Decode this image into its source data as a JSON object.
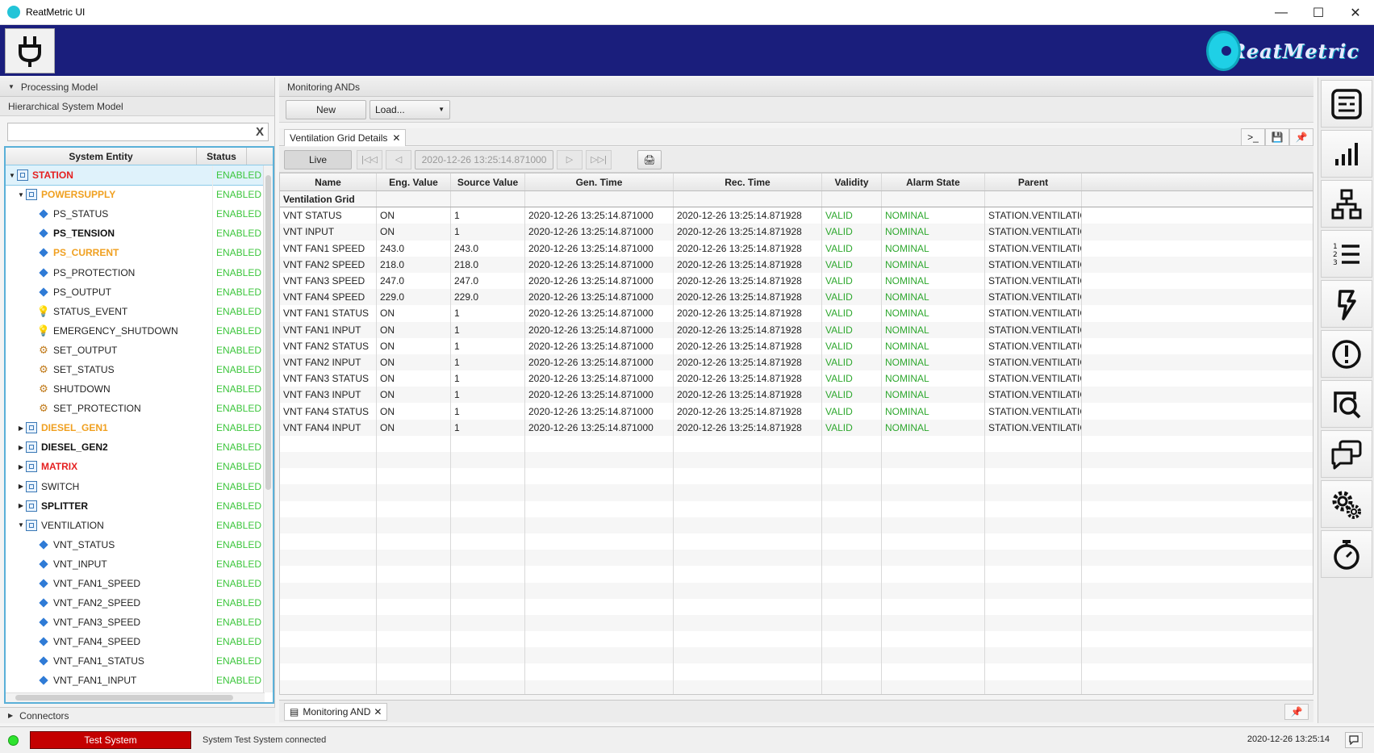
{
  "window": {
    "title": "ReatMetric UI",
    "minimize": "—",
    "maximize": "☐",
    "close": "✕"
  },
  "logo": {
    "text": "ReatMetric"
  },
  "left_panel": {
    "processing_model_label": "Processing Model",
    "hierarchical_label": "Hierarchical System Model",
    "filter_value": "",
    "filter_clear": "X",
    "columns": [
      "System Entity",
      "Status"
    ],
    "tree": [
      {
        "label": "STATION",
        "level": 0,
        "toggle": "▼",
        "icon": "system",
        "style": "red",
        "status": "ENABLED",
        "selected": true
      },
      {
        "label": "POWERSUPPLY",
        "level": 1,
        "toggle": "▼",
        "icon": "system",
        "style": "orange",
        "status": "ENABLED"
      },
      {
        "label": "PS_STATUS",
        "level": 2,
        "toggle": "",
        "icon": "parameter",
        "style": "normal",
        "status": "ENABLED"
      },
      {
        "label": "PS_TENSION",
        "level": 2,
        "toggle": "",
        "icon": "parameter",
        "style": "bold",
        "status": "ENABLED"
      },
      {
        "label": "PS_CURRENT",
        "level": 2,
        "toggle": "",
        "icon": "parameter",
        "style": "orange",
        "status": "ENABLED"
      },
      {
        "label": "PS_PROTECTION",
        "level": 2,
        "toggle": "",
        "icon": "parameter",
        "style": "normal",
        "status": "ENABLED"
      },
      {
        "label": "PS_OUTPUT",
        "level": 2,
        "toggle": "",
        "icon": "parameter",
        "style": "normal",
        "status": "ENABLED"
      },
      {
        "label": "STATUS_EVENT",
        "level": 2,
        "toggle": "",
        "icon": "event",
        "style": "normal",
        "status": "ENABLED"
      },
      {
        "label": "EMERGENCY_SHUTDOWN",
        "level": 2,
        "toggle": "",
        "icon": "event",
        "style": "normal",
        "status": "ENABLED"
      },
      {
        "label": "SET_OUTPUT",
        "level": 2,
        "toggle": "",
        "icon": "activity",
        "style": "normal",
        "status": "ENABLED"
      },
      {
        "label": "SET_STATUS",
        "level": 2,
        "toggle": "",
        "icon": "activity",
        "style": "normal",
        "status": "ENABLED"
      },
      {
        "label": "SHUTDOWN",
        "level": 2,
        "toggle": "",
        "icon": "activity",
        "style": "normal",
        "status": "ENABLED"
      },
      {
        "label": "SET_PROTECTION",
        "level": 2,
        "toggle": "",
        "icon": "activity",
        "style": "normal",
        "status": "ENABLED"
      },
      {
        "label": "DIESEL_GEN1",
        "level": 1,
        "toggle": "▶",
        "icon": "system",
        "style": "orange",
        "status": "ENABLED"
      },
      {
        "label": "DIESEL_GEN2",
        "level": 1,
        "toggle": "▶",
        "icon": "system",
        "style": "bold",
        "status": "ENABLED"
      },
      {
        "label": "MATRIX",
        "level": 1,
        "toggle": "▶",
        "icon": "system",
        "style": "red",
        "status": "ENABLED"
      },
      {
        "label": "SWITCH",
        "level": 1,
        "toggle": "▶",
        "icon": "system",
        "style": "normal",
        "status": "ENABLED"
      },
      {
        "label": "SPLITTER",
        "level": 1,
        "toggle": "▶",
        "icon": "system",
        "style": "bold",
        "status": "ENABLED"
      },
      {
        "label": "VENTILATION",
        "level": 1,
        "toggle": "▼",
        "icon": "system",
        "style": "normal",
        "status": "ENABLED"
      },
      {
        "label": "VNT_STATUS",
        "level": 2,
        "toggle": "",
        "icon": "parameter",
        "style": "normal",
        "status": "ENABLED"
      },
      {
        "label": "VNT_INPUT",
        "level": 2,
        "toggle": "",
        "icon": "parameter",
        "style": "normal",
        "status": "ENABLED"
      },
      {
        "label": "VNT_FAN1_SPEED",
        "level": 2,
        "toggle": "",
        "icon": "parameter",
        "style": "normal",
        "status": "ENABLED"
      },
      {
        "label": "VNT_FAN2_SPEED",
        "level": 2,
        "toggle": "",
        "icon": "parameter",
        "style": "normal",
        "status": "ENABLED"
      },
      {
        "label": "VNT_FAN3_SPEED",
        "level": 2,
        "toggle": "",
        "icon": "parameter",
        "style": "normal",
        "status": "ENABLED"
      },
      {
        "label": "VNT_FAN4_SPEED",
        "level": 2,
        "toggle": "",
        "icon": "parameter",
        "style": "normal",
        "status": "ENABLED"
      },
      {
        "label": "VNT_FAN1_STATUS",
        "level": 2,
        "toggle": "",
        "icon": "parameter",
        "style": "normal",
        "status": "ENABLED"
      },
      {
        "label": "VNT_FAN1_INPUT",
        "level": 2,
        "toggle": "",
        "icon": "parameter",
        "style": "normal",
        "status": "ENABLED"
      }
    ],
    "connectors_label": "Connectors"
  },
  "main": {
    "header": "Monitoring ANDs",
    "new_button": "New",
    "load_button": "Load...",
    "tab_label": "Ventilation Grid Details",
    "tab_close": "✕",
    "live_button": "Live",
    "time_field": "2020-12-26 13:25:14.871000",
    "grid": {
      "columns": [
        "Name",
        "Eng. Value",
        "Source Value",
        "Gen. Time",
        "Rec. Time",
        "Validity",
        "Alarm State",
        "Parent"
      ],
      "group": "Ventilation Grid",
      "rows": [
        [
          "VNT STATUS",
          "ON",
          "1",
          "2020-12-26 13:25:14.871000",
          "2020-12-26 13:25:14.871928",
          "VALID",
          "NOMINAL",
          "STATION.VENTILATION"
        ],
        [
          "VNT INPUT",
          "ON",
          "1",
          "2020-12-26 13:25:14.871000",
          "2020-12-26 13:25:14.871928",
          "VALID",
          "NOMINAL",
          "STATION.VENTILATION"
        ],
        [
          "VNT FAN1 SPEED",
          "243.0",
          "243.0",
          "2020-12-26 13:25:14.871000",
          "2020-12-26 13:25:14.871928",
          "VALID",
          "NOMINAL",
          "STATION.VENTILATION"
        ],
        [
          "VNT FAN2 SPEED",
          "218.0",
          "218.0",
          "2020-12-26 13:25:14.871000",
          "2020-12-26 13:25:14.871928",
          "VALID",
          "NOMINAL",
          "STATION.VENTILATION"
        ],
        [
          "VNT FAN3 SPEED",
          "247.0",
          "247.0",
          "2020-12-26 13:25:14.871000",
          "2020-12-26 13:25:14.871928",
          "VALID",
          "NOMINAL",
          "STATION.VENTILATION"
        ],
        [
          "VNT FAN4 SPEED",
          "229.0",
          "229.0",
          "2020-12-26 13:25:14.871000",
          "2020-12-26 13:25:14.871928",
          "VALID",
          "NOMINAL",
          "STATION.VENTILATION"
        ],
        [
          "VNT FAN1 STATUS",
          "ON",
          "1",
          "2020-12-26 13:25:14.871000",
          "2020-12-26 13:25:14.871928",
          "VALID",
          "NOMINAL",
          "STATION.VENTILATION"
        ],
        [
          "VNT FAN1 INPUT",
          "ON",
          "1",
          "2020-12-26 13:25:14.871000",
          "2020-12-26 13:25:14.871928",
          "VALID",
          "NOMINAL",
          "STATION.VENTILATION"
        ],
        [
          "VNT FAN2 STATUS",
          "ON",
          "1",
          "2020-12-26 13:25:14.871000",
          "2020-12-26 13:25:14.871928",
          "VALID",
          "NOMINAL",
          "STATION.VENTILATION"
        ],
        [
          "VNT FAN2 INPUT",
          "ON",
          "1",
          "2020-12-26 13:25:14.871000",
          "2020-12-26 13:25:14.871928",
          "VALID",
          "NOMINAL",
          "STATION.VENTILATION"
        ],
        [
          "VNT FAN3 STATUS",
          "ON",
          "1",
          "2020-12-26 13:25:14.871000",
          "2020-12-26 13:25:14.871928",
          "VALID",
          "NOMINAL",
          "STATION.VENTILATION"
        ],
        [
          "VNT FAN3 INPUT",
          "ON",
          "1",
          "2020-12-26 13:25:14.871000",
          "2020-12-26 13:25:14.871928",
          "VALID",
          "NOMINAL",
          "STATION.VENTILATION"
        ],
        [
          "VNT FAN4 STATUS",
          "ON",
          "1",
          "2020-12-26 13:25:14.871000",
          "2020-12-26 13:25:14.871928",
          "VALID",
          "NOMINAL",
          "STATION.VENTILATION"
        ],
        [
          "VNT FAN4 INPUT",
          "ON",
          "1",
          "2020-12-26 13:25:14.871000",
          "2020-12-26 13:25:14.871928",
          "VALID",
          "NOMINAL",
          "STATION.VENTILATION"
        ]
      ]
    },
    "bottom_tab_label": "Monitoring AND",
    "bottom_tab_close": "✕"
  },
  "right_sidebar": [
    "dashboard-icon",
    "chart-icon",
    "hierarchy-icon",
    "list-icon",
    "activity-icon",
    "alarm-icon",
    "search-icon",
    "chat-icon",
    "settings-icon",
    "timer-icon"
  ],
  "status_bar": {
    "system_name": "Test System",
    "message": "System Test System connected",
    "clock": "2020-12-26 13:25:14"
  },
  "colors": {
    "header_bg": "#1a1e7c",
    "enabled": "#3cc63c",
    "valid": "#2fa82f",
    "system_bad": "#c40000",
    "led": "#2ee32e"
  }
}
